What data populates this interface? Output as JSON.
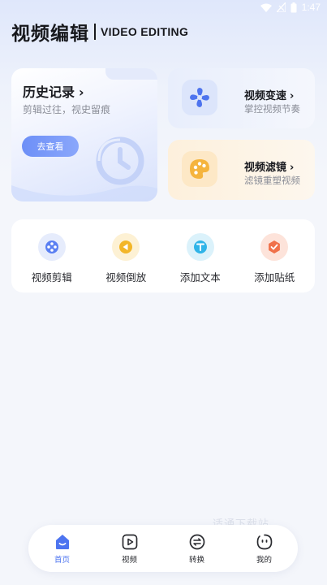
{
  "status_bar": {
    "time": "1:47"
  },
  "header": {
    "title": "视频编辑",
    "subtitle": "VIDEO EDITING"
  },
  "history_card": {
    "title": "历史记录",
    "arrow": "›",
    "subtitle": "剪辑过往，视史留痕",
    "button_label": "去查看"
  },
  "speed_card": {
    "title": "视频变速",
    "arrow": "›",
    "subtitle": "掌控视频节奏",
    "icon": "fan-icon"
  },
  "filter_card": {
    "title": "视频滤镜",
    "arrow": "›",
    "subtitle": "滤镜重塑视频",
    "icon": "palette-icon"
  },
  "tools": [
    {
      "label": "视频剪辑",
      "icon": "film-reel-icon",
      "color": "#5a7ff2",
      "bg": "#e6ecfc"
    },
    {
      "label": "视频倒放",
      "icon": "rewind-icon",
      "color": "#f3b628",
      "bg": "#fdf1d4"
    },
    {
      "label": "添加文本",
      "icon": "text-icon",
      "color": "#2fb4e8",
      "bg": "#dbf2fb"
    },
    {
      "label": "添加贴纸",
      "icon": "sticker-icon",
      "color": "#f0714a",
      "bg": "#fde3da"
    }
  ],
  "bottom_nav": [
    {
      "label": "首页",
      "icon": "home-icon",
      "active": true
    },
    {
      "label": "视频",
      "icon": "video-icon",
      "active": false
    },
    {
      "label": "转换",
      "icon": "convert-icon",
      "active": false
    },
    {
      "label": "我的",
      "icon": "profile-icon",
      "active": false
    }
  ],
  "watermark": "适通下载站",
  "colors": {
    "accent": "#4d74f0",
    "background": "#f4f6fb"
  }
}
